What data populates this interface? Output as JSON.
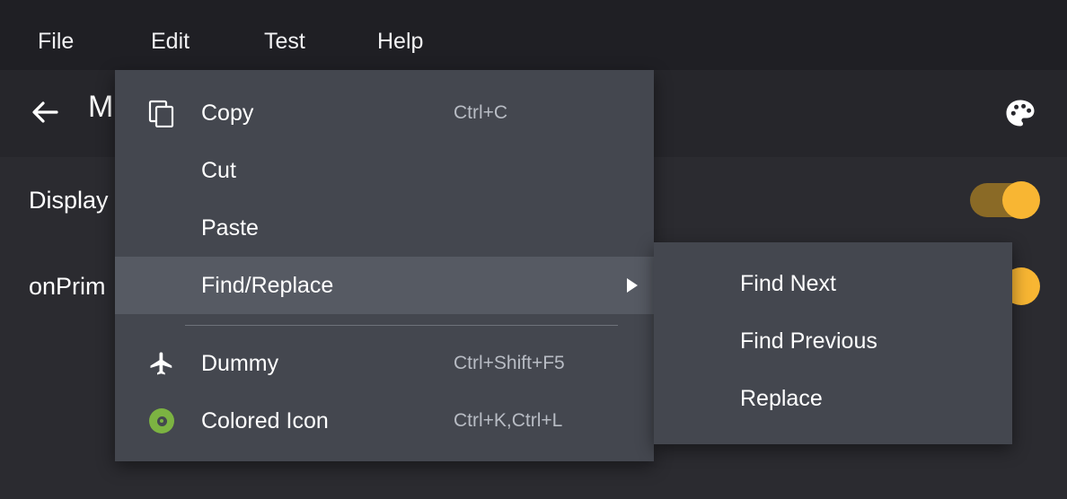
{
  "window": {
    "background": "#2b2b30",
    "header_background": "#26262b",
    "menubar_background": "#1f1f24"
  },
  "menubar": {
    "items": [
      {
        "label": "File",
        "active": false
      },
      {
        "label": "Edit",
        "active": true
      },
      {
        "label": "Test",
        "active": false
      },
      {
        "label": "Help",
        "active": false
      }
    ]
  },
  "appbar": {
    "back_icon": "arrow-left-icon",
    "title": "M",
    "action_icon": "palette-icon"
  },
  "settings_rows": [
    {
      "label": "Display",
      "toggle_on": true,
      "toggle_track_color": "#8a6a26",
      "toggle_knob_color": "#f8b633"
    },
    {
      "label": "onPrim",
      "toggle_on": true,
      "toggle_track_color": "#8a6a26",
      "toggle_knob_color": "#f8b633"
    }
  ],
  "edit_menu": {
    "background": "#44474f",
    "highlight_color": "#565a63",
    "items": [
      {
        "label": "Copy",
        "shortcut": "Ctrl+C",
        "icon": "copy-icon",
        "highlighted": false,
        "submenu": false
      },
      {
        "label": "Cut",
        "shortcut": "",
        "icon": "",
        "highlighted": false,
        "submenu": false
      },
      {
        "label": "Paste",
        "shortcut": "",
        "icon": "",
        "highlighted": false,
        "submenu": false
      },
      {
        "label": "Find/Replace",
        "shortcut": "",
        "icon": "",
        "highlighted": true,
        "submenu": true
      },
      {
        "label": "Dummy",
        "shortcut": "Ctrl+Shift+F5",
        "icon": "airplane-icon",
        "highlighted": false,
        "submenu": false
      },
      {
        "label": "Colored Icon",
        "shortcut": "Ctrl+K,Ctrl+L",
        "icon": "green-disc-icon",
        "highlighted": false,
        "submenu": false
      }
    ],
    "separator_after_index": 3,
    "icon_accent_color": "#7cb342"
  },
  "find_submenu": {
    "background": "#44474f",
    "items": [
      {
        "label": "Find Next",
        "shortcut": ""
      },
      {
        "label": "Find Previous",
        "shortcut": ""
      },
      {
        "label": "Replace",
        "shortcut": ""
      }
    ]
  }
}
